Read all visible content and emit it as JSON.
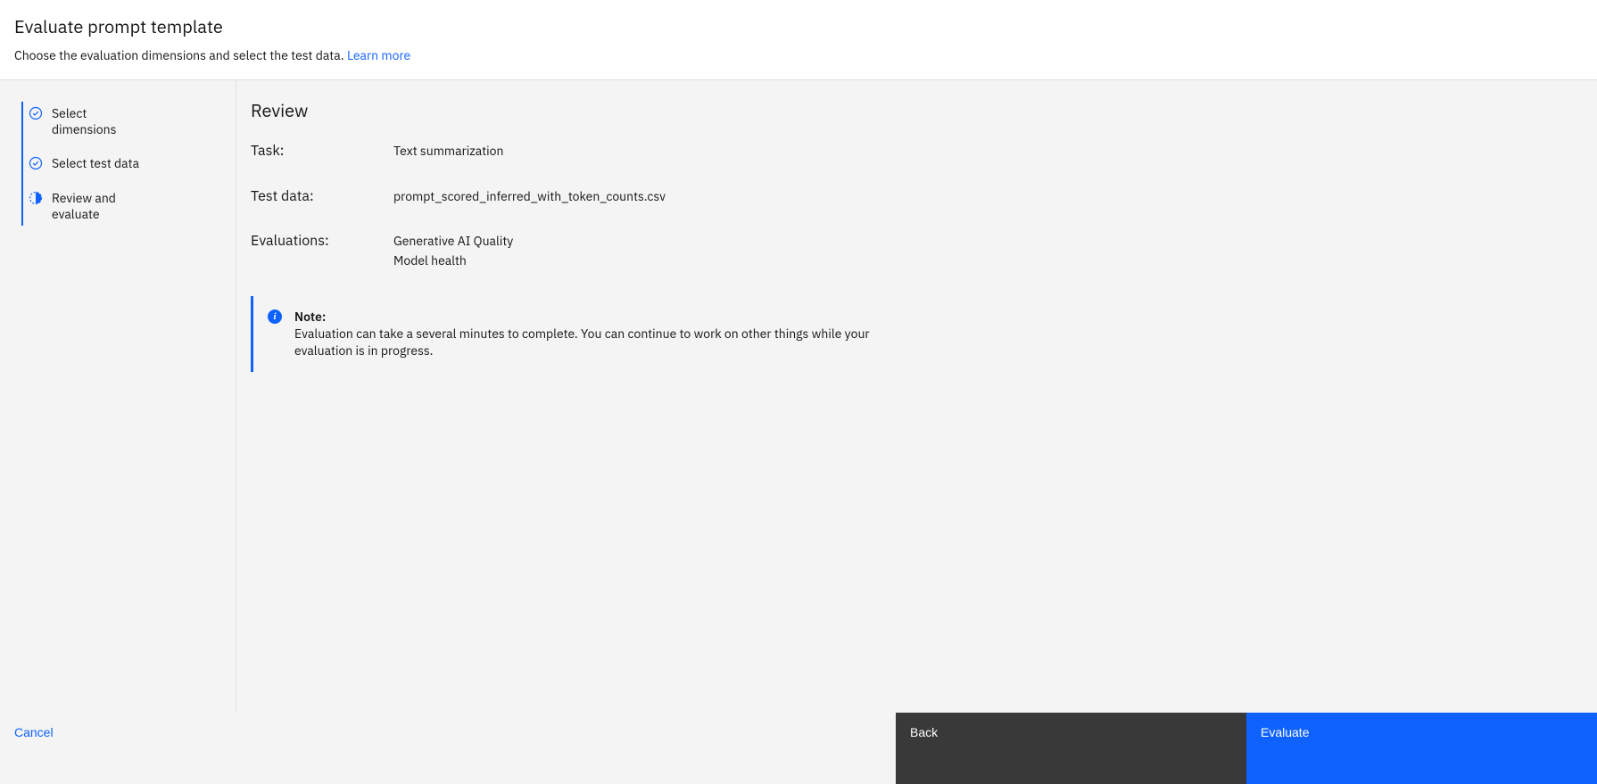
{
  "header": {
    "title": "Evaluate prompt template",
    "subtitle": "Choose the evaluation dimensions and select the test data. ",
    "learn_more": "Learn more"
  },
  "sidebar": {
    "steps": [
      {
        "label": "Select dimensions",
        "status": "complete"
      },
      {
        "label": "Select test data",
        "status": "complete"
      },
      {
        "label": "Review and evaluate",
        "status": "current"
      }
    ]
  },
  "main": {
    "section_title": "Review",
    "rows": [
      {
        "label": "Task:",
        "values": [
          "Text summarization"
        ]
      },
      {
        "label": "Test data:",
        "values": [
          "prompt_scored_inferred_with_token_counts.csv"
        ]
      },
      {
        "label": "Evaluations:",
        "values": [
          "Generative AI Quality",
          "Model health"
        ]
      }
    ],
    "note": {
      "title": "Note:",
      "body": "Evaluation can take a several minutes to complete. You can continue to work on other things while your evaluation is in progress."
    }
  },
  "footer": {
    "cancel": "Cancel",
    "back": "Back",
    "evaluate": "Evaluate"
  }
}
